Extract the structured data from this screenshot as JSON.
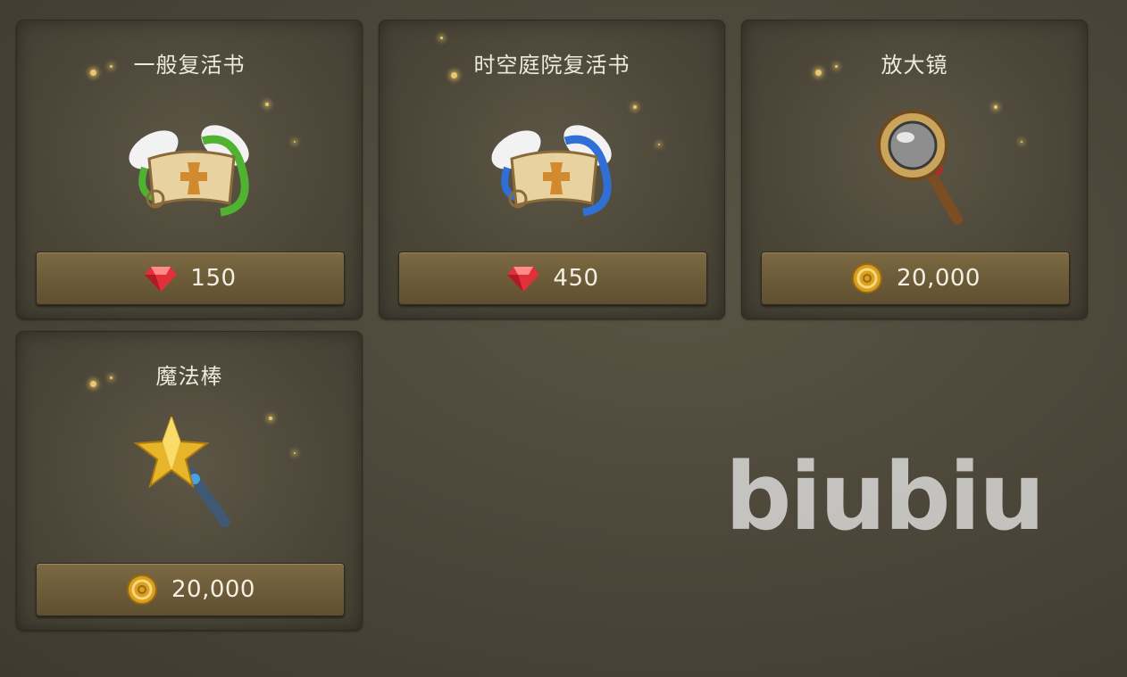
{
  "shop": {
    "items": [
      {
        "name": "一般复活书",
        "price": "150",
        "currency": "ruby-icon",
        "icon": "winged-scroll-green-icon"
      },
      {
        "name": "时空庭院复活书",
        "price": "450",
        "currency": "ruby-icon",
        "icon": "winged-scroll-blue-icon"
      },
      {
        "name": "放大镜",
        "price": "20,000",
        "currency": "gold-coin-icon",
        "icon": "magnifying-glass-icon"
      },
      {
        "name": "魔法棒",
        "price": "20,000",
        "currency": "gold-coin-icon",
        "icon": "magic-wand-icon"
      }
    ]
  },
  "watermark": "biubiu",
  "colors": {
    "background": "#4a4538",
    "button": "#6e5d3a",
    "ruby": "#e0303a",
    "gold": "#d9a021"
  }
}
